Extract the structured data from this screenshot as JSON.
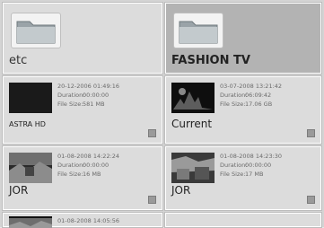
{
  "folders": [
    {
      "label": "etc",
      "icon": "folder-icon",
      "selected": false
    },
    {
      "label": "FASHION TV",
      "icon": "folder-icon",
      "selected": true
    }
  ],
  "recordings": [
    {
      "datetime": "20-12-2006 01:49:16",
      "duration_key": "Duration:",
      "duration": "00:00:00",
      "size_key": "File Size:",
      "size": "581 MB",
      "title": "ASTRA HD"
    },
    {
      "datetime": "03-07-2008 13:21:42",
      "duration_key": "Duration:",
      "duration": "06:09:42",
      "size_key": "File Size:",
      "size": "17.06 GB",
      "title": "Current"
    },
    {
      "datetime": "01-08-2008 14:22:24",
      "duration_key": "Duration:",
      "duration": "00:00:00",
      "size_key": "File Size:",
      "size": "16 MB",
      "title": "JOR"
    },
    {
      "datetime": "01-08-2008 14:23:30",
      "duration_key": "Duration:",
      "duration": "00:00:00",
      "size_key": "File Size:",
      "size": "17 MB",
      "title": "JOR"
    },
    {
      "datetime": "01-08-2008 14:05:56"
    }
  ]
}
